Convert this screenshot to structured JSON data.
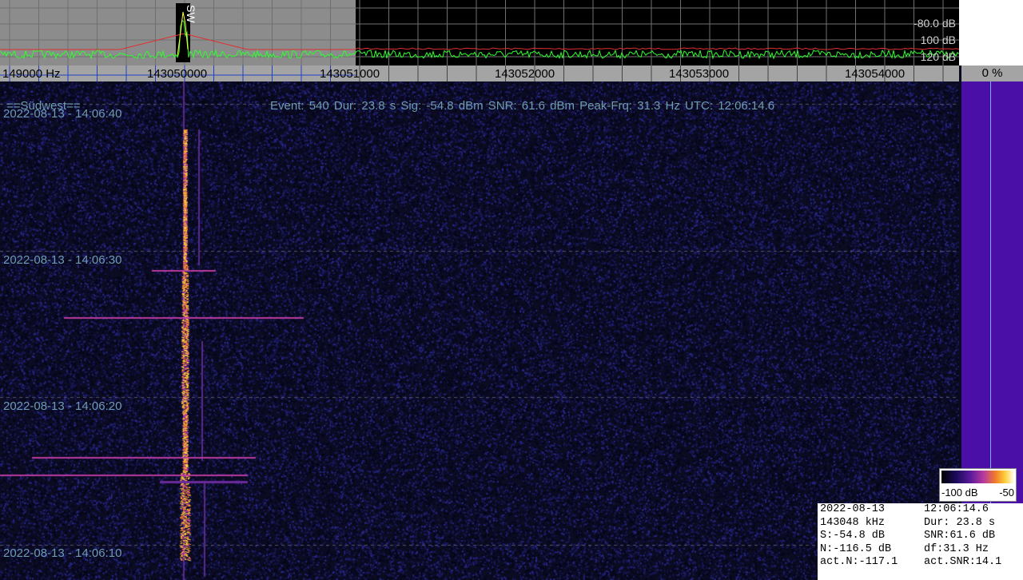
{
  "spectrum": {
    "db_labels": [
      "-80.0 dB",
      "100 dB",
      "120 dB"
    ],
    "marker_label": "SW"
  },
  "axis": {
    "freq_labels": [
      "149000 Hz",
      "143050000",
      "143051000",
      "143052000",
      "143053000",
      "143054000"
    ],
    "percent": "0 %"
  },
  "waterfall": {
    "station": "==Südwest==",
    "event_line": "Event: 540   Dur: 23.8 s   Sig: -54.8 dBm   SNR: 61.6 dBm   Peak-Frq: 31.3 Hz   UTC: 12:06:14.6",
    "timestamps": [
      "2022-08-13 - 14:06:40",
      "2022-08-13 - 14:06:30",
      "2022-08-13 - 14:06:20",
      "2022-08-13 - 14:06:10"
    ]
  },
  "colorbar": {
    "low": "-100 dB",
    "high": "-50"
  },
  "info": {
    "rows": [
      [
        "2022-08-13",
        "12:06:14.6"
      ],
      [
        "143048 kHz",
        "Dur: 23.8 s"
      ],
      [
        "S:-54.8 dB",
        "SNR:61.6 dB"
      ],
      [
        "N:-116.5 dB",
        "df:31.3 Hz"
      ],
      [
        "act.N:-117.1",
        "act.SNR:14.1"
      ]
    ]
  },
  "colors": {
    "grid": "#7a7a7a",
    "spectrum_green": "#2cff2c",
    "spectrum_red": "#e03030",
    "signal": "#ffd23a",
    "level_bar": "#4a0fa6"
  }
}
